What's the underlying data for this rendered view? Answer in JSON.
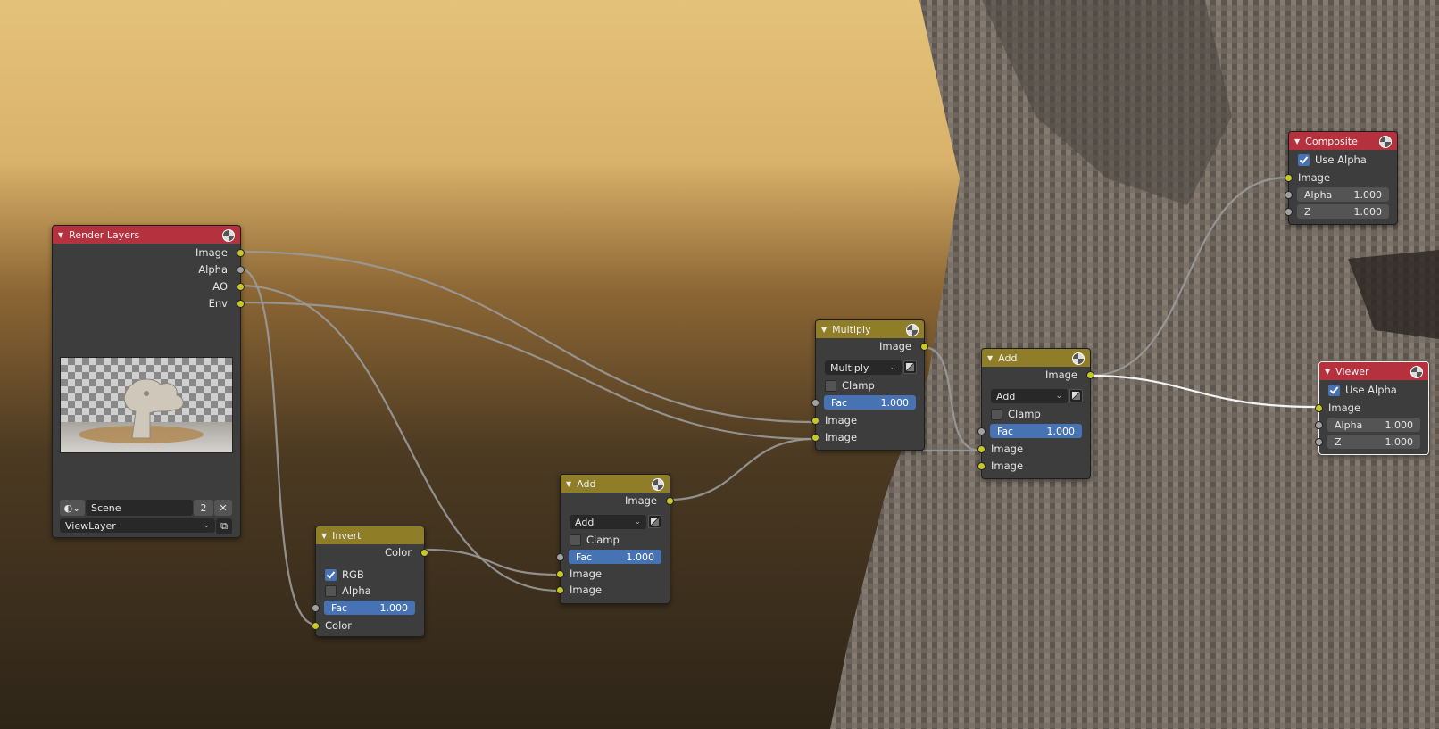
{
  "render_layers": {
    "title": "Render Layers",
    "outputs": [
      "Image",
      "Alpha",
      "AO",
      "Env"
    ],
    "scene": "Scene",
    "users": "2",
    "view_layer": "ViewLayer",
    "close_glyph": "✕"
  },
  "invert": {
    "title": "Invert",
    "output": "Color",
    "rgb_label": "RGB",
    "rgb_checked": true,
    "alpha_label": "Alpha",
    "alpha_checked": false,
    "fac_label": "Fac",
    "fac_value": "1.000",
    "input_color": "Color"
  },
  "add_small": {
    "title": "Add",
    "output": "Image",
    "blend_mode": "Add",
    "clamp_label": "Clamp",
    "fac_label": "Fac",
    "fac_value": "1.000",
    "input1": "Image",
    "input2": "Image"
  },
  "multiply": {
    "title": "Multiply",
    "output": "Image",
    "blend_mode": "Multiply",
    "clamp_label": "Clamp",
    "fac_label": "Fac",
    "fac_value": "1.000",
    "input1": "Image",
    "input2": "Image"
  },
  "add_big": {
    "title": "Add",
    "output": "Image",
    "blend_mode": "Add",
    "clamp_label": "Clamp",
    "fac_label": "Fac",
    "fac_value": "1.000",
    "input1": "Image",
    "input2": "Image"
  },
  "composite": {
    "title": "Composite",
    "use_alpha_label": "Use Alpha",
    "input_image": "Image",
    "alpha_label": "Alpha",
    "alpha_value": "1.000",
    "z_label": "Z",
    "z_value": "1.000"
  },
  "viewer": {
    "title": "Viewer",
    "use_alpha_label": "Use Alpha",
    "input_image": "Image",
    "alpha_label": "Alpha",
    "alpha_value": "1.000",
    "z_label": "Z",
    "z_value": "1.000"
  },
  "colors": {
    "output_node_header": "#b5313e",
    "color_node_header": "#8f7d28",
    "color_socket": "#c7c729",
    "value_socket": "#a1a1a1",
    "slider_blue": "#4772b3"
  }
}
